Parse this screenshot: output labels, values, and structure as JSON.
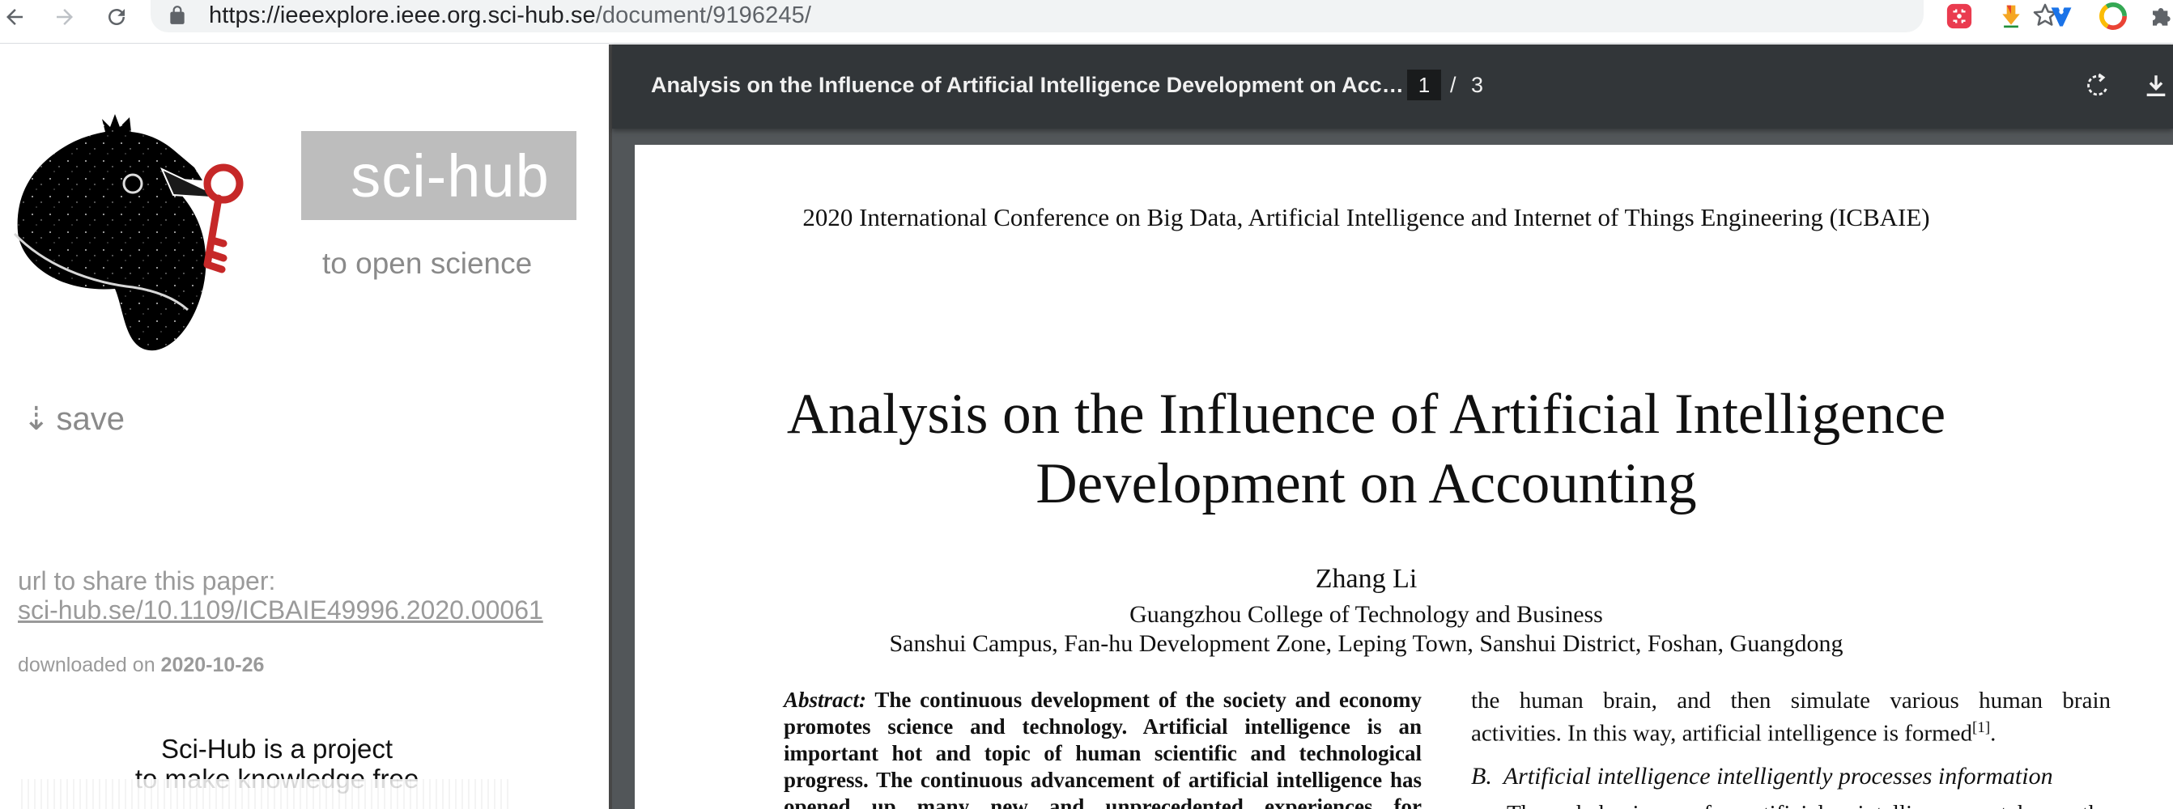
{
  "browser": {
    "url_host": "https://ieeexplore.ieee.org.sci-hub.se",
    "url_path": "/document/9196245/",
    "back_icon": "arrow-left",
    "forward_icon": "arrow-right",
    "reload_icon": "reload",
    "star_icon": "star-outline",
    "extensions": [
      "screenshot-extension",
      "download-extension",
      "vpn-extension",
      "chrome-colorful-extension",
      "puzzle-extension"
    ]
  },
  "scihub": {
    "brand": "sci-hub",
    "tagline": "to open science",
    "save_arrow": "⇣",
    "save_label": "save",
    "share_label": "url to share this paper:",
    "share_url": "sci-hub.se/10.1109/ICBAIE49996.2020.00061",
    "downloaded_prefix": "downloaded on",
    "downloaded_date": "2020-10-26",
    "project_line1": "Sci-Hub is a project",
    "project_line2": "to make knowledge free"
  },
  "pdf_viewer": {
    "title": "Analysis on the Influence of Artificial Intelligence Development on Accounting",
    "current_page": "1",
    "separator": "/",
    "total_pages": "3",
    "colors": {
      "toolbar": "#323639",
      "background": "#525659"
    }
  },
  "paper": {
    "conference": "2020 International Conference on Big Data, Artificial Intelligence and Internet of Things Engineering  (ICBAIE)",
    "title_line1": "Analysis on the Influence of Artificial Intelligence",
    "title_line2": "Development on Accounting",
    "author": "Zhang Li",
    "affiliation1": "Guangzhou College of Technology and Business",
    "affiliation2": "Sanshui Campus, Fan-hu Development Zone, Leping Town, Sanshui District, Foshan, Guangdong",
    "abstract_label": "Abstract:",
    "abstract_text": "The continuous development of the society and economy promotes science and technology. Artificial intelligence is an important hot and topic of human scientific and technological progress. The continuous advancement of artificial intelligence has opened up many new and unprecedented experiences for",
    "right_line1": "the human brain, and then simulate various human brain",
    "right_line2": "activities. In this way, artificial intelligence is formed",
    "right_ref": "[1]",
    "right_line2_end": ".",
    "section_number": "B.",
    "section_title": "Artificial intelligence intelligently processes information",
    "right_line3": "The behavior of artificial intelligence takes the"
  }
}
